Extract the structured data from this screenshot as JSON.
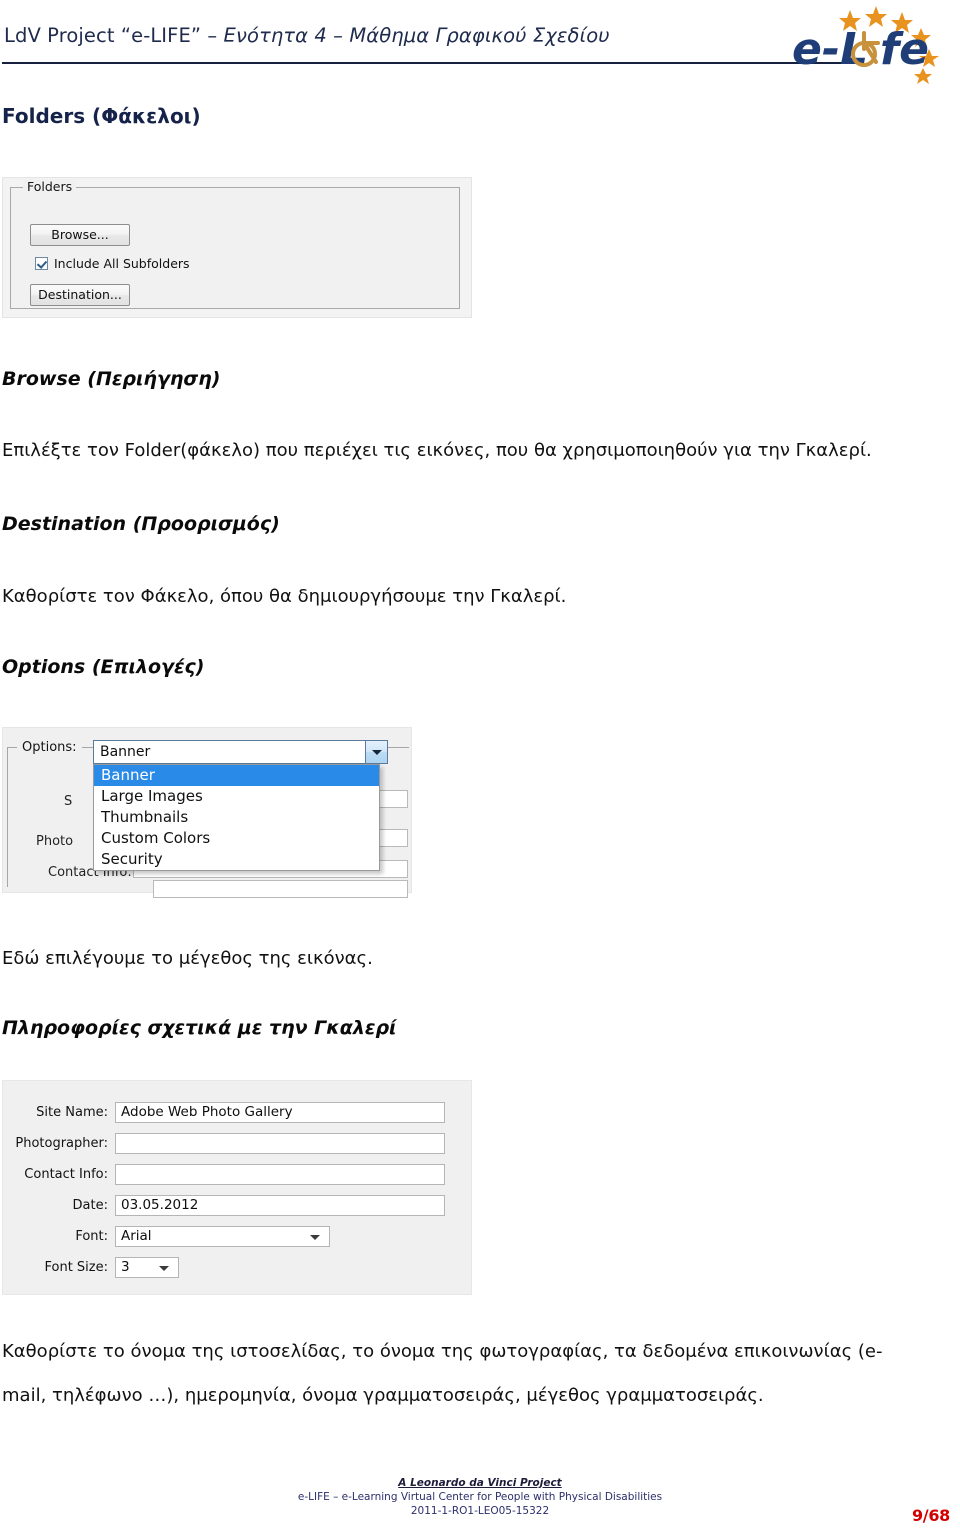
{
  "header": {
    "title_regular": "LdV Project “e-LIFE” – ",
    "title_italic": "Ενότητα 4 – Μάθημα Γραφικού Σχεδίου",
    "logo_text": "e-Life",
    "logo_alt": "e-LIFE logo with stars and wheelchair symbol"
  },
  "colors": {
    "heading_blue": "#15224a",
    "header_navy": "#1f2b4d",
    "logo_blue": "#1f3e78",
    "logo_orange": "#e8921f",
    "logo_tan": "#c8923c",
    "selection_blue": "#2a8ae8",
    "page_number_red": "#d30000",
    "footer_blue": "#2b2f6b"
  },
  "sections": {
    "folders_heading": "Folders (Φάκελοι)",
    "browse_heading": "Browse (Περιήγηση)",
    "browse_text": "Επιλέξτε τον Folder(φάκελο) που περιέχει τις εικόνες, που θα χρησιμοποιηθούν για την Γκαλερί.",
    "destination_heading": "Destination (Προορισμός)",
    "destination_text": "Καθορίστε τον Φάκελο, όπου θα δημιουργήσουμε την Γκαλερί.",
    "options_heading": "Options (Επιλογές)",
    "options_text": "Εδώ επιλέγουμε το μέγεθος της εικόνας.",
    "gallery_info_heading": "Πληροφορίες σχετικά με την Γκαλερί",
    "gallery_info_text_line1": "Καθορίστε το όνομα της ιστοσελίδας, το όνομα της φωτογραφίας, τα δεδομένα επικοινωνίας (e-",
    "gallery_info_text_line2": "mail, τηλέφωνο …), ημερομηνία, όνομα γραμματοσειράς, μέγεθος γραμματοσειράς."
  },
  "folders_dialog": {
    "group_legend": "Folders",
    "browse_button": "Browse...",
    "include_subfolders_label": "Include All Subfolders",
    "include_subfolders_checked": true,
    "destination_button": "Destination..."
  },
  "options_dialog": {
    "label": "Options:",
    "selected_value": "Banner",
    "items": [
      "Banner",
      "Large Images",
      "Thumbnails",
      "Custom Colors",
      "Security"
    ],
    "selected_index": 0,
    "obscured_labels": {
      "site_name": "S",
      "photographer": "Photo",
      "contact_info": "Contact Info:"
    }
  },
  "gallery_info_dialog": {
    "rows": [
      {
        "label": "Site Name:",
        "value": "Adobe Web Photo Gallery",
        "type": "text"
      },
      {
        "label": "Photographer:",
        "value": "",
        "type": "text"
      },
      {
        "label": "Contact Info:",
        "value": "",
        "type": "text"
      },
      {
        "label": "Date:",
        "value": "03.05.2012",
        "type": "text"
      },
      {
        "label": "Font:",
        "value": "Arial",
        "type": "combo"
      },
      {
        "label": "Font Size:",
        "value": "3",
        "type": "combo"
      }
    ]
  },
  "footer": {
    "line1": "A Leonardo da Vinci Project",
    "line2": "e-LIFE – e-Learning Virtual Center for People with Physical Disabilities",
    "line3": "2011-1-RO1-LEO05-15322",
    "page_number": "9/68"
  }
}
